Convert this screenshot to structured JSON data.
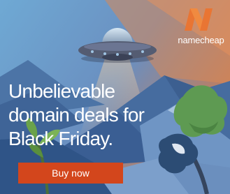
{
  "brand": {
    "name": "namecheap",
    "logo_icon": "namecheap-n-logo-icon"
  },
  "headline": {
    "lines": [
      "Unbelievable",
      "domain deals for",
      "Black Friday."
    ]
  },
  "cta": {
    "label": "Buy now"
  },
  "illustration": {
    "subject": "ufo-icon"
  },
  "colors": {
    "background": "#5ea0cf",
    "sky_glow": "#cf7a4c",
    "mountain": "#3a5e93",
    "ufo_body": "#545c72",
    "tree_foliage": "#5e9a52",
    "cta_background": "#d3461c",
    "logo_orange": "#e97533",
    "text": "#ffffff"
  }
}
